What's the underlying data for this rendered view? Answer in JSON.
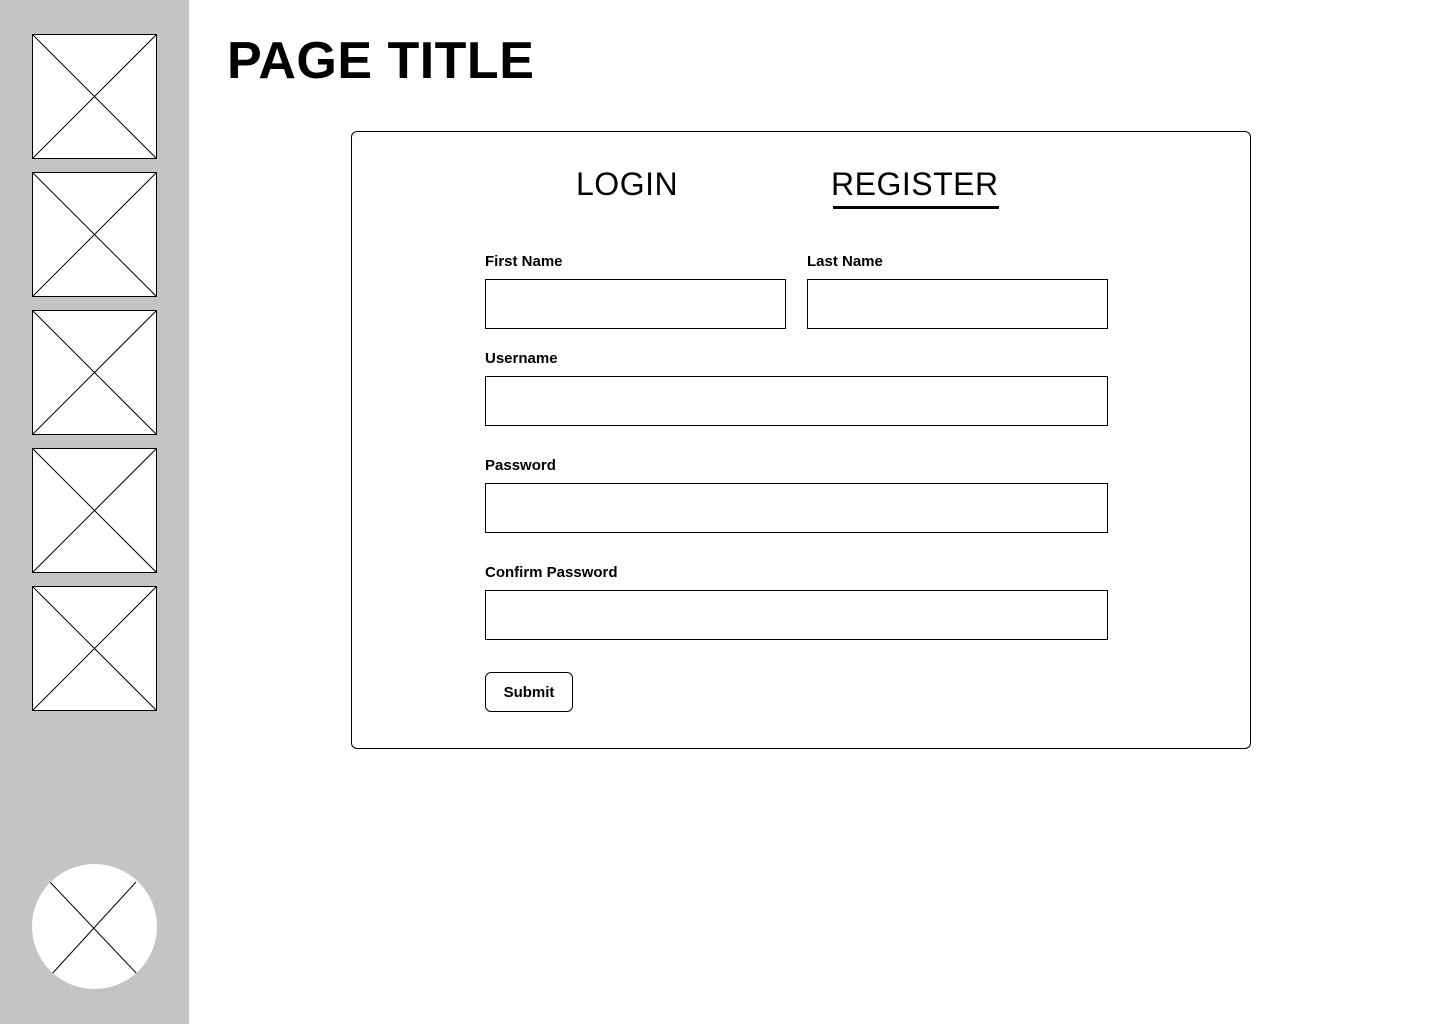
{
  "sidebar": {
    "items": [
      {
        "icon": "image-placeholder-icon"
      },
      {
        "icon": "image-placeholder-icon"
      },
      {
        "icon": "image-placeholder-icon"
      },
      {
        "icon": "image-placeholder-icon"
      },
      {
        "icon": "image-placeholder-icon"
      }
    ],
    "avatar_icon": "avatar-placeholder-icon",
    "background_color": "#c4c4c4"
  },
  "header": {
    "title": "PAGE TITLE"
  },
  "auth": {
    "tabs": [
      {
        "label": "LOGIN",
        "active": false
      },
      {
        "label": "REGISTER",
        "active": true
      }
    ],
    "form": {
      "first_name_label": "First Name",
      "first_name_value": "",
      "last_name_label": "Last Name",
      "last_name_value": "",
      "username_label": "Username",
      "username_value": "",
      "password_label": "Password",
      "password_value": "",
      "confirm_password_label": "Confirm Password",
      "confirm_password_value": "",
      "submit_label": "Submit"
    }
  }
}
